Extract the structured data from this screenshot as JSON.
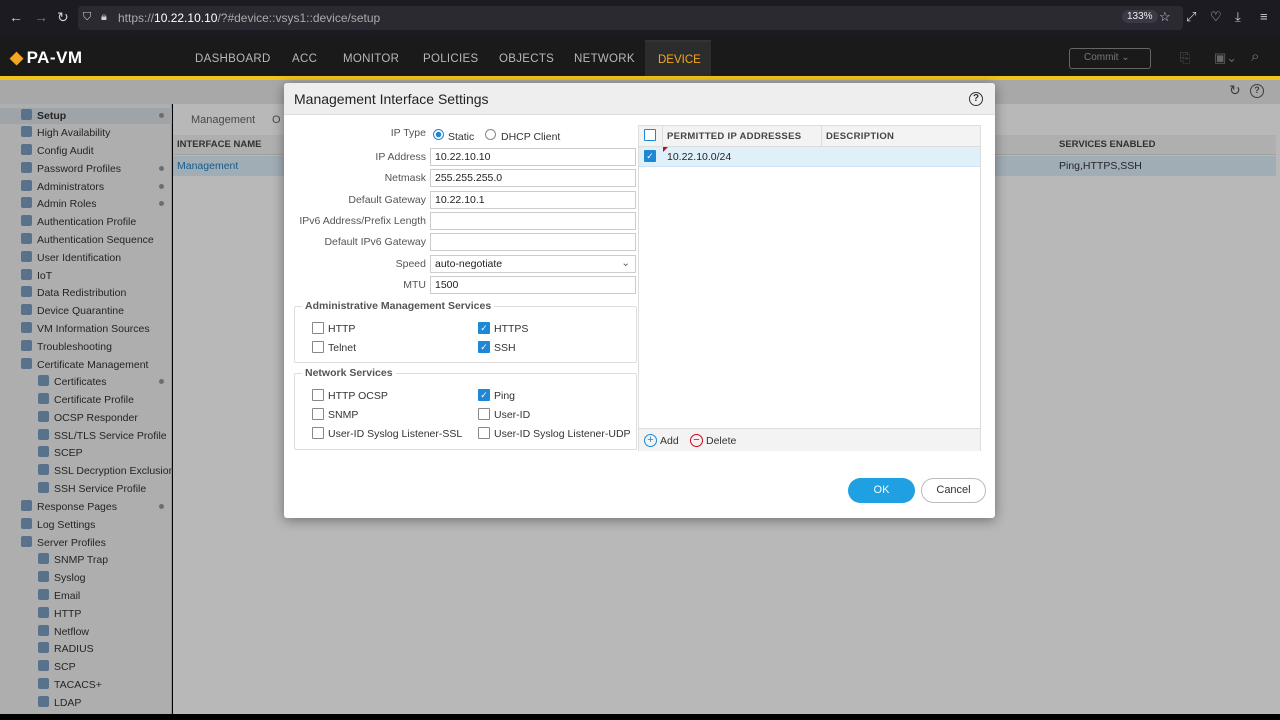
{
  "browser": {
    "url_prefix": "https://",
    "url_host": "10.22.10.10",
    "url_path": "/?#device::vsys1::device/setup",
    "zoom": "133%"
  },
  "app": {
    "logo": "PA-VM",
    "tabs": [
      "DASHBOARD",
      "ACC",
      "MONITOR",
      "POLICIES",
      "OBJECTS",
      "NETWORK",
      "DEVICE"
    ],
    "active_tab": "DEVICE",
    "commit_label": "Commit"
  },
  "sidebar": {
    "items": [
      {
        "label": "Setup",
        "bold": true
      },
      {
        "label": "High Availability"
      },
      {
        "label": "Config Audit"
      },
      {
        "label": "Password Profiles"
      },
      {
        "label": "Administrators"
      },
      {
        "label": "Admin Roles"
      },
      {
        "label": "Authentication Profile"
      },
      {
        "label": "Authentication Sequence"
      },
      {
        "label": "User Identification"
      },
      {
        "label": "IoT"
      },
      {
        "label": "Data Redistribution"
      },
      {
        "label": "Device Quarantine"
      },
      {
        "label": "VM Information Sources"
      },
      {
        "label": "Troubleshooting"
      },
      {
        "label": "Certificate Management"
      },
      {
        "label": "Certificates"
      },
      {
        "label": "Certificate Profile"
      },
      {
        "label": "OCSP Responder"
      },
      {
        "label": "SSL/TLS Service Profile"
      },
      {
        "label": "SCEP"
      },
      {
        "label": "SSL Decryption Exclusion"
      },
      {
        "label": "SSH Service Profile"
      },
      {
        "label": "Response Pages"
      },
      {
        "label": "Log Settings"
      },
      {
        "label": "Server Profiles"
      },
      {
        "label": "SNMP Trap"
      },
      {
        "label": "Syslog"
      },
      {
        "label": "Email"
      },
      {
        "label": "HTTP"
      },
      {
        "label": "Netflow"
      },
      {
        "label": "RADIUS"
      },
      {
        "label": "SCP"
      },
      {
        "label": "TACACS+"
      },
      {
        "label": "LDAP"
      }
    ]
  },
  "background": {
    "subtab": "Management",
    "subtab_cut": "O",
    "col_interface": "INTERFACE NAME",
    "col_services": "SERVICES ENABLED",
    "row_interface": "Management",
    "row_services": "Ping,HTTPS,SSH"
  },
  "dialog": {
    "title": "Management Interface Settings",
    "ip_type_label": "IP Type",
    "ip_type_static": "Static",
    "ip_type_dhcp": "DHCP Client",
    "ip_address_label": "IP Address",
    "ip_address": "10.22.10.10",
    "netmask_label": "Netmask",
    "netmask": "255.255.255.0",
    "gateway_label": "Default Gateway",
    "gateway": "10.22.10.1",
    "ipv6_label": "IPv6 Address/Prefix Length",
    "ipv6": "",
    "ipv6_gateway_label": "Default IPv6 Gateway",
    "ipv6_gateway": "",
    "speed_label": "Speed",
    "speed": "auto-negotiate",
    "mtu_label": "MTU",
    "mtu": "1500",
    "admin_services_legend": "Administrative Management Services",
    "http": "HTTP",
    "https": "HTTPS",
    "telnet": "Telnet",
    "ssh": "SSH",
    "network_services_legend": "Network Services",
    "http_ocsp": "HTTP OCSP",
    "ping": "Ping",
    "snmp": "SNMP",
    "userid": "User-ID",
    "userid_ssl": "User-ID Syslog Listener-SSL",
    "userid_udp": "User-ID Syslog Listener-UDP",
    "grid_col_ip": "PERMITTED IP ADDRESSES",
    "grid_col_desc": "DESCRIPTION",
    "grid_row_ip": "10.22.10.0/24",
    "add_label": "Add",
    "delete_label": "Delete",
    "ok_label": "OK",
    "cancel_label": "Cancel"
  }
}
